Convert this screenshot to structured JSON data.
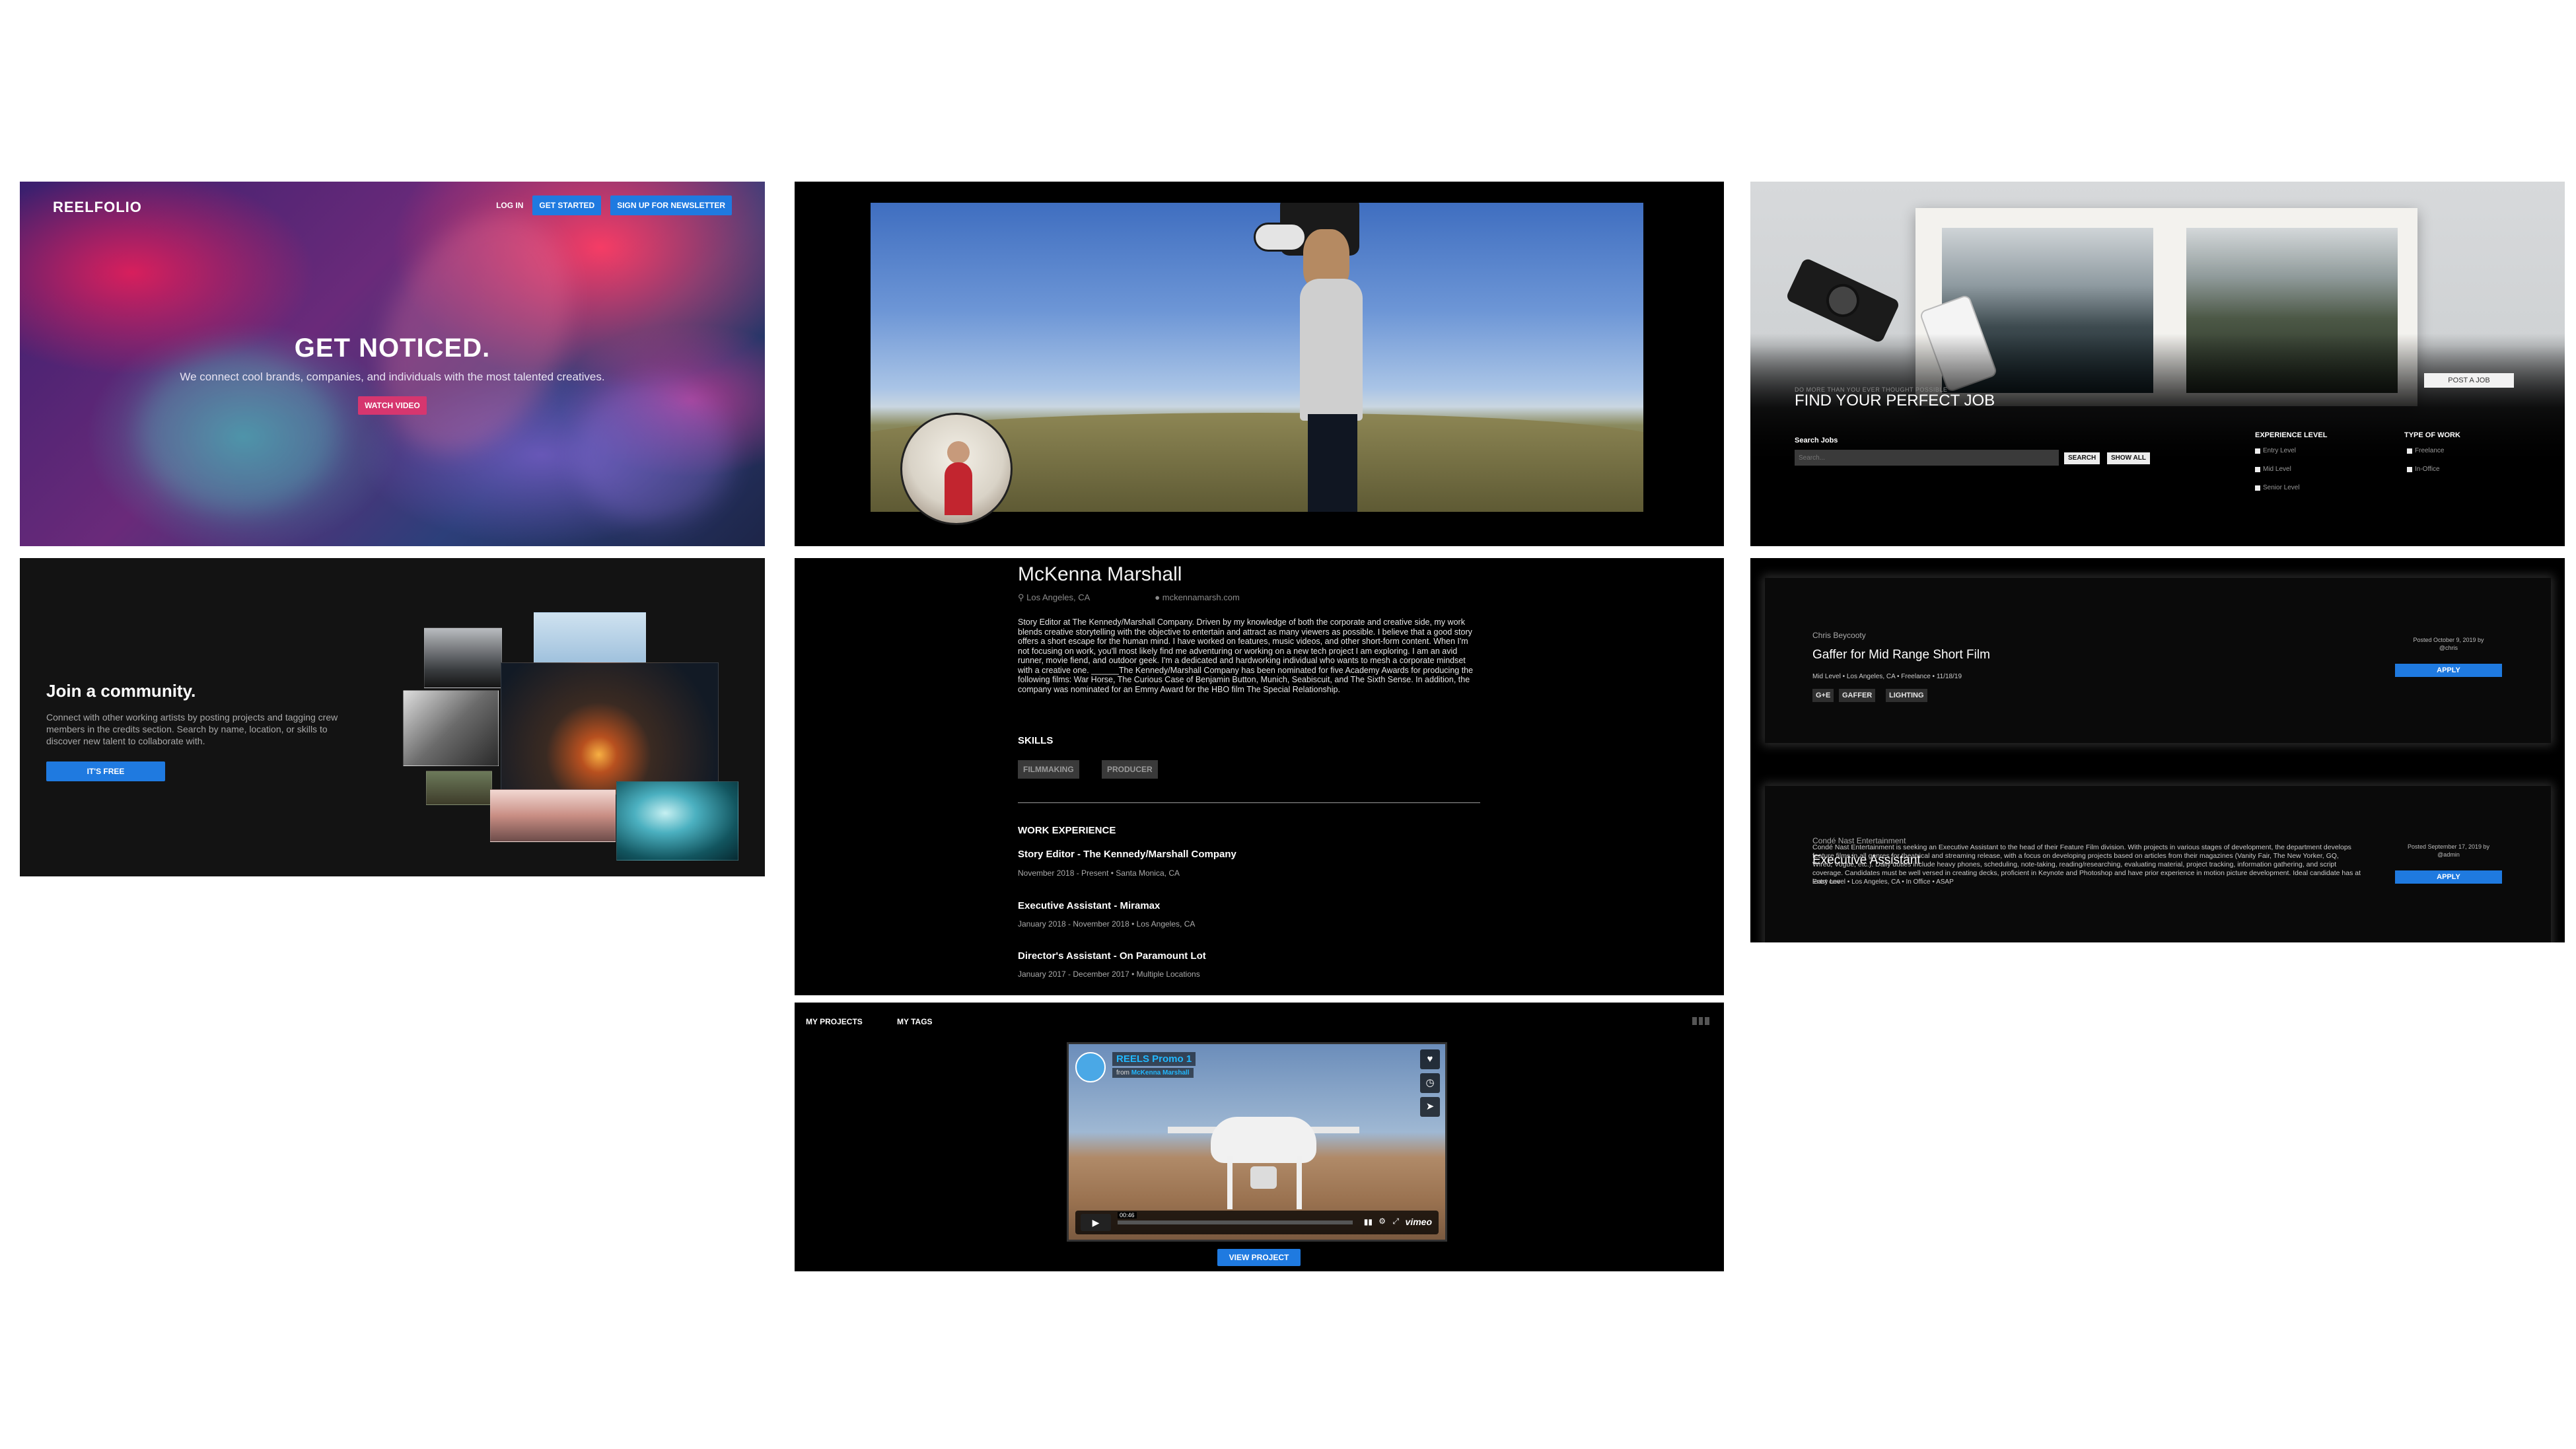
{
  "hero": {
    "logo": "REELFOLIO",
    "nav": {
      "login": "LOG IN",
      "get_started": "GET STARTED",
      "newsletter": "SIGN UP FOR NEWSLETTER"
    },
    "title": "GET NOTICED.",
    "subtitle": "We connect cool brands, companies, and individuals with the most talented creatives.",
    "cta": "WATCH VIDEO"
  },
  "community": {
    "title": "Join a community.",
    "text": "Connect with other working artists by posting projects and tagging crew members in the credits section. Search by name, location, or skills to discover new talent to collaborate with.",
    "cta": "IT'S FREE"
  },
  "profile": {
    "name": "McKenna Marshall",
    "location": "Los Angeles, CA",
    "website": "mckennamarsh.com",
    "bio": "Story Editor at The Kennedy/Marshall Company. Driven by my knowledge of both the corporate and creative side, my work blends creative storytelling with the objective to entertain and attract as many viewers as possible. I believe that a good story offers a short escape for the human mind. I have worked on features, music videos, and other short-form content. When I'm not focusing on work, you'll most likely find me adventuring or working on a new tech project I am exploring. I am an avid runner, movie fiend, and outdoor geek. I'm a dedicated and hardworking individual who wants to mesh a corporate mindset with a creative one. ______The Kennedy/Marshall Company has been nominated for five Academy Awards for producing the following films: War Horse, The Curious Case of Benjamin Button, Munich, Seabiscuit, and The Sixth Sense. In addition, the company was nominated for an Emmy Award for the HBO film The Special Relationship.",
    "skills_heading": "SKILLS",
    "skills": [
      "FILMMAKING",
      "PRODUCER"
    ],
    "experience_heading": "WORK EXPERIENCE",
    "experience": [
      {
        "title": "Story Editor - The Kennedy/Marshall Company",
        "meta": "November 2018 - Present • Santa Monica, CA"
      },
      {
        "title": "Executive Assistant - Miramax",
        "meta": "January 2018 - November 2018 • Los Angeles, CA"
      },
      {
        "title": "Director's Assistant - On Paramount Lot",
        "meta": "January 2017 - December 2017 • Multiple Locations"
      }
    ]
  },
  "projects": {
    "tabs": [
      "MY PROJECTS",
      "MY TAGS"
    ],
    "video_title": "REELS Promo 1",
    "video_from_prefix": "from",
    "video_from_name": "McKenna Marshall",
    "video_time": "00:46",
    "video_brand": "vimeo",
    "view_button": "VIEW PROJECT"
  },
  "jobs": {
    "eyebrow": "DO MORE THAN YOU EVER THOUGHT POSSIBLE",
    "title": "FIND YOUR PERFECT JOB",
    "post_button": "POST A JOB",
    "search_label": "Search Jobs",
    "search_placeholder": "Search...",
    "search_button": "SEARCH",
    "show_all_button": "SHOW ALL",
    "experience_heading": "EXPERIENCE LEVEL",
    "experience_levels": [
      "Entry Level",
      "Mid Level",
      "Senior Level"
    ],
    "work_heading": "TYPE OF WORK",
    "work_types": [
      "Freelance",
      "In-Office"
    ]
  },
  "listings": [
    {
      "company": "Chris Beycooty",
      "title": "Gaffer for Mid Range Short Film",
      "meta": "Mid Level • Los Angeles, CA • Freelance • 11/18/19",
      "tags": [
        "G+E",
        "GAFFER",
        "LIGHTING"
      ],
      "posted": "Posted October 9, 2019 by",
      "posted_by": "@chris",
      "apply": "APPLY"
    },
    {
      "company": "Condé Nast Entertainment",
      "title": "Executive Assistant",
      "meta": "Entry Level • Los Angeles, CA • In Office • ASAP",
      "description": "Condé Nast Entertainment is seeking an Executive Assistant to the head of their Feature Film division. With projects in various stages of development, the department develops feature films in all genres for theatrical and streaming release, with a focus on developing projects based on articles from their magazines (Vanity Fair, The New Yorker, GQ, Wired, Vogue, etc.). Daily duties include heavy phones, scheduling, note-taking, reading/researching, evaluating material, project tracking, information gathering, and script coverage. Candidates must be well versed in creating decks, proficient in Keynote and Photoshop and have prior experience in motion picture development. Ideal candidate has at least one",
      "posted": "Posted September 17, 2019 by",
      "posted_by": "@admin",
      "apply": "APPLY"
    }
  ]
}
